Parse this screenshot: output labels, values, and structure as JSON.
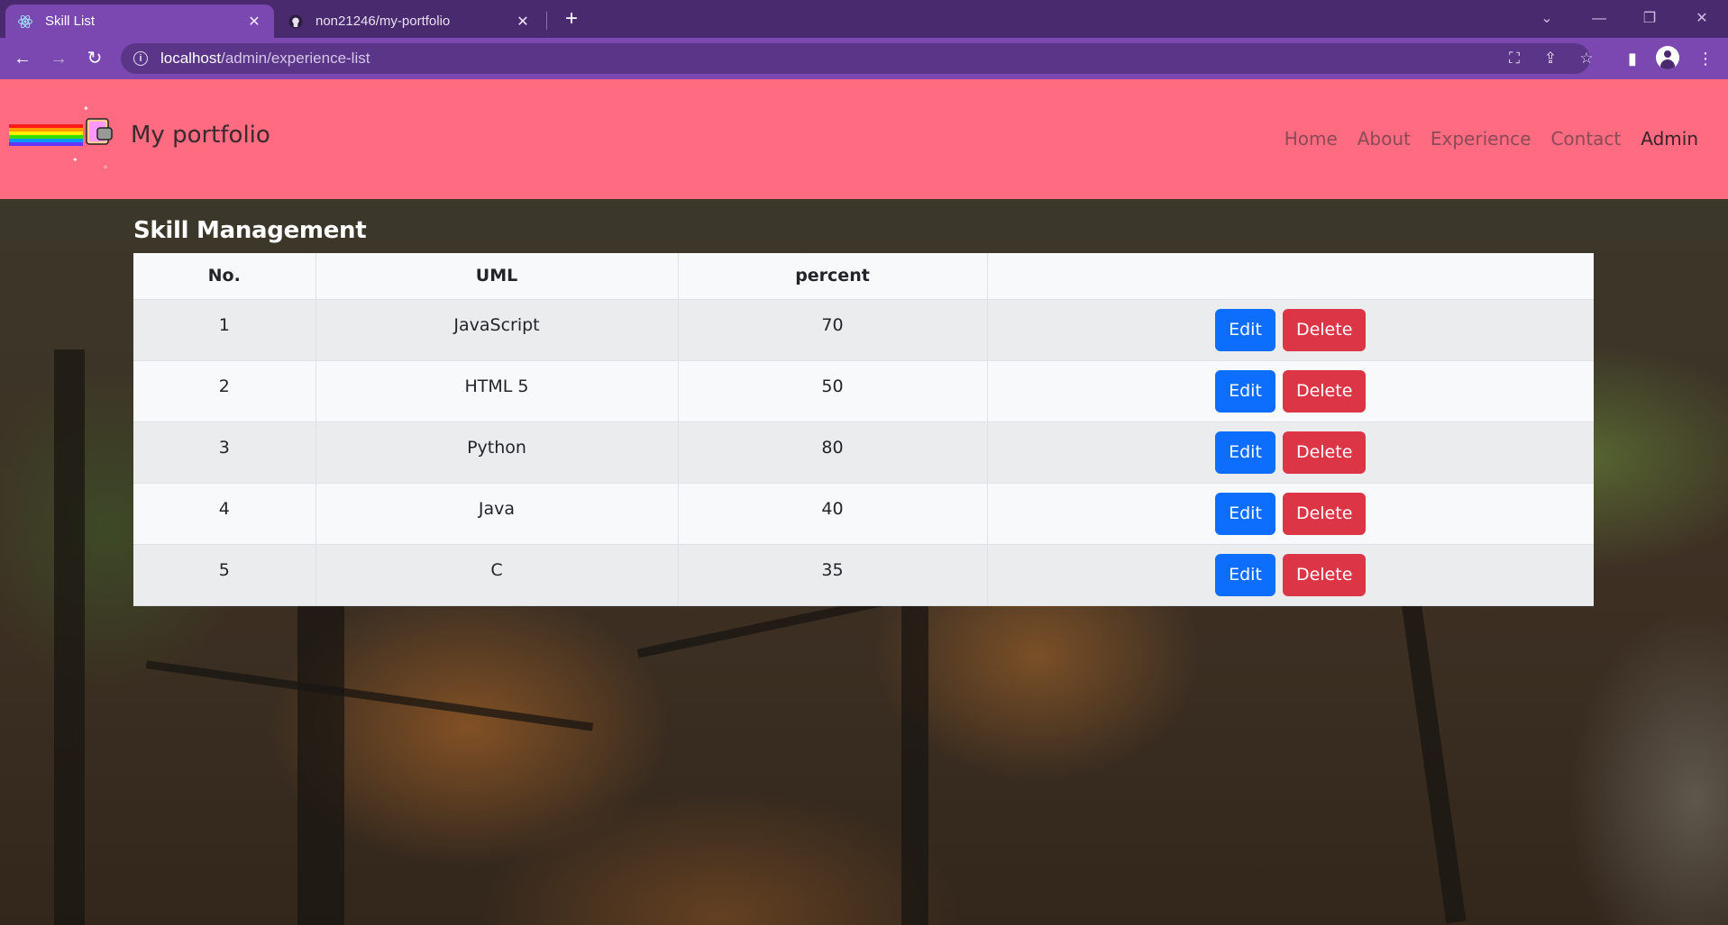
{
  "browser": {
    "tabs": [
      {
        "title": "Skill List",
        "active": true,
        "icon": "react-icon"
      },
      {
        "title": "non21246/my-portfolio",
        "active": false,
        "icon": "github-icon"
      }
    ],
    "url_host": "localhost",
    "url_path": "/admin/experience-list",
    "colors": {
      "tabbar": "#4a2a6e",
      "toolbar": "#7a48b0"
    }
  },
  "navbar": {
    "brand": "My portfolio",
    "links": [
      "Home",
      "About",
      "Experience",
      "Contact",
      "Admin"
    ],
    "active_link": "Admin",
    "color": "#ff6b81"
  },
  "main": {
    "title": "Skill Management",
    "table": {
      "headers": [
        "No.",
        "UML",
        "percent",
        ""
      ],
      "rows": [
        {
          "no": "1",
          "name": "JavaScript",
          "percent": "70"
        },
        {
          "no": "2",
          "name": "HTML 5",
          "percent": "50"
        },
        {
          "no": "3",
          "name": "Python",
          "percent": "80"
        },
        {
          "no": "4",
          "name": "Java",
          "percent": "40"
        },
        {
          "no": "5",
          "name": "C",
          "percent": "35"
        }
      ],
      "edit_label": "Edit",
      "delete_label": "Delete"
    },
    "colors": {
      "edit": "#0d6efd",
      "delete": "#dc3545"
    }
  }
}
